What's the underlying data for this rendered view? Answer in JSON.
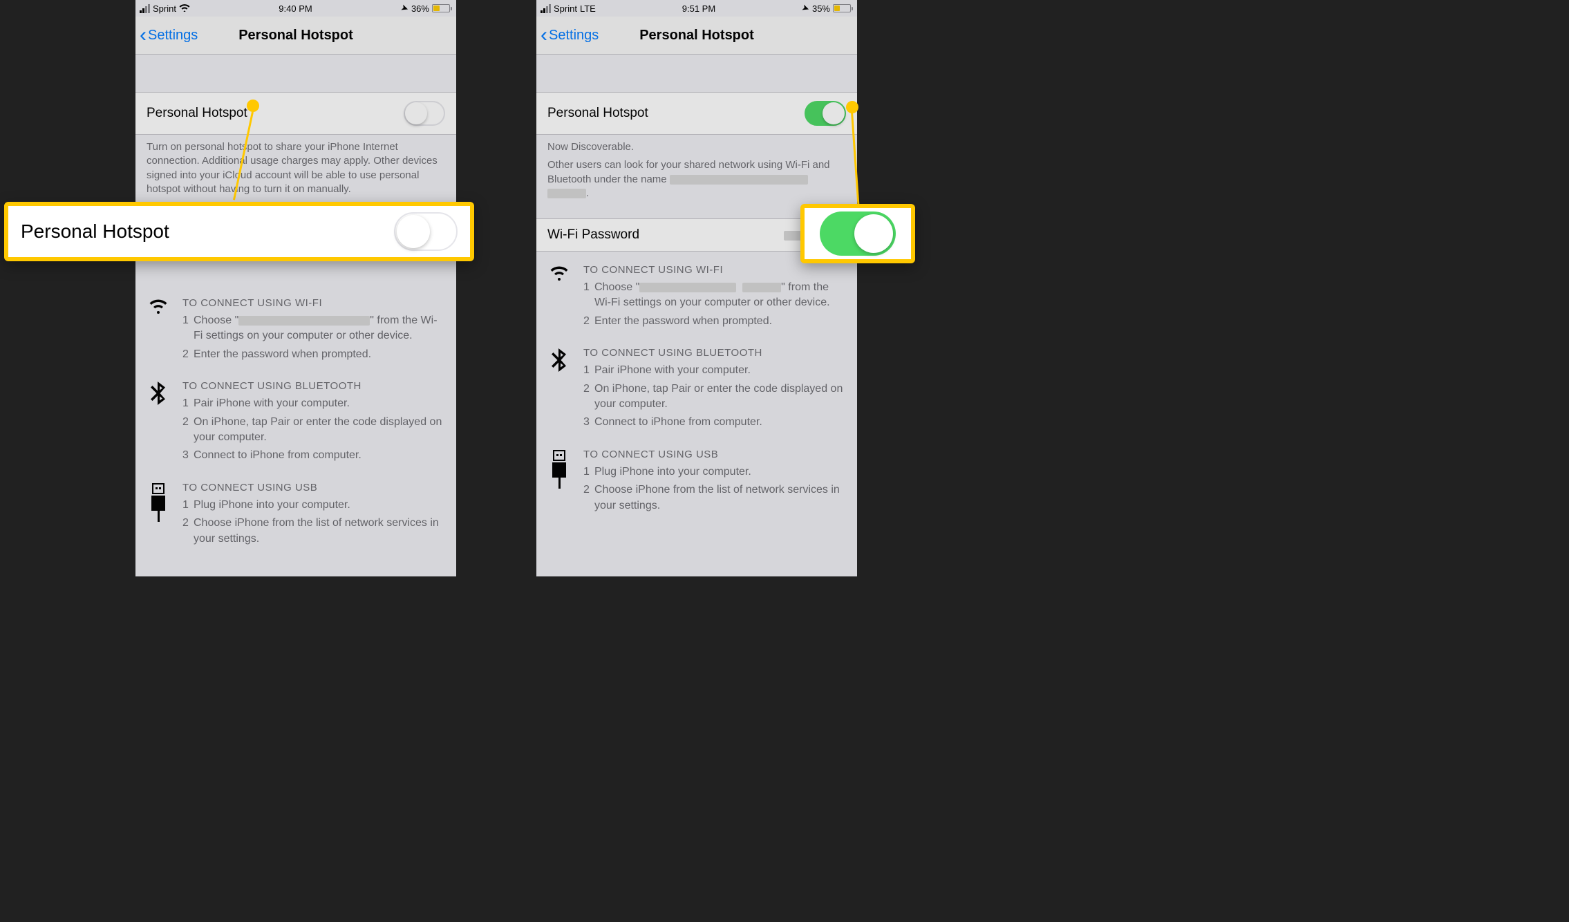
{
  "left": {
    "status": {
      "carrier": "Sprint",
      "net_glyph": "wifi",
      "time": "9:40 PM",
      "battery_pct": "36%",
      "battery_fill": 36
    },
    "nav": {
      "back": "Settings",
      "title": "Personal Hotspot"
    },
    "hotspot": {
      "label": "Personal Hotspot",
      "on": false
    },
    "off_description": "Turn on personal hotspot to share your iPhone Internet connection. Additional usage charges may apply. Other devices signed into your iCloud account will be able to use personal hotspot without having to turn it on manually.",
    "wifi": {
      "heading": "TO CONNECT USING WI-FI",
      "steps": [
        "Choose “[redacted]” from the Wi-Fi settings on your computer or other device.",
        "Enter the password when prompted."
      ]
    },
    "bt": {
      "heading": "TO CONNECT USING BLUETOOTH",
      "steps": [
        "Pair iPhone with your computer.",
        "On iPhone, tap Pair or enter the code displayed on your computer.",
        "Connect to iPhone from computer."
      ]
    },
    "usb": {
      "heading": "TO CONNECT USING USB",
      "steps": [
        "Plug iPhone into your computer.",
        "Choose iPhone from the list of network services in your settings."
      ]
    }
  },
  "right": {
    "status": {
      "carrier": "Sprint",
      "net_glyph": "LTE",
      "time": "9:51 PM",
      "battery_pct": "35%",
      "battery_fill": 35
    },
    "nav": {
      "back": "Settings",
      "title": "Personal Hotspot"
    },
    "hotspot": {
      "label": "Personal Hotspot",
      "on": true
    },
    "discoverable_title": "Now Discoverable.",
    "discoverable_body": "Other users can look for your shared network using Wi-Fi and Bluetooth under the name [redacted].",
    "pw": {
      "label": "Wi-Fi Password",
      "value": "[redacted]"
    },
    "wifi": {
      "heading": "TO CONNECT USING WI-FI",
      "steps": [
        "Choose “[redacted]” from the Wi-Fi settings on your computer or other device.",
        "Enter the password when prompted."
      ]
    },
    "bt": {
      "heading": "TO CONNECT USING BLUETOOTH",
      "steps": [
        "Pair iPhone with your computer.",
        "On iPhone, tap Pair or enter the code displayed on your computer.",
        "Connect to iPhone from computer."
      ]
    },
    "usb": {
      "heading": "TO CONNECT USING USB",
      "steps": [
        "Plug iPhone into your computer.",
        "Choose iPhone from the list of network services in your settings."
      ]
    }
  },
  "callout1_label": "Personal Hotspot"
}
